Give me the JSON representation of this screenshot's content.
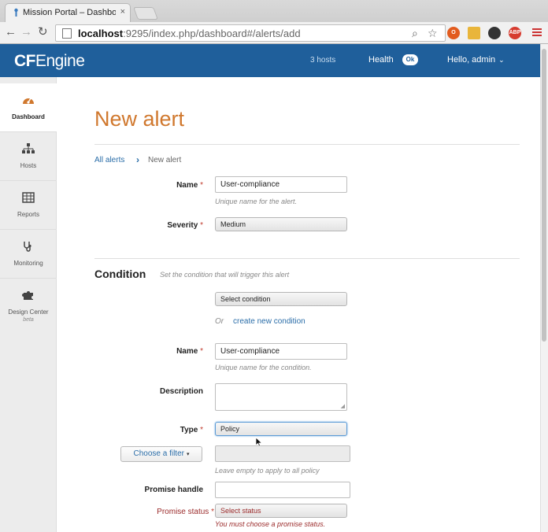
{
  "browser": {
    "tab_title": "Mission Portal – Dashboar",
    "tab_close": "×",
    "url_host": "localhost",
    "url_rest": ":9295/index.php/dashboard#/alerts/add",
    "extensions": {
      "abp_label": "ABP"
    }
  },
  "header": {
    "logo_bold": "CF",
    "logo_rest": "Engine",
    "hosts": "3 hosts",
    "health_label": "Health",
    "health_badge": "Ok",
    "user_menu": "Hello, admin",
    "brand_color": "#1f5f9b"
  },
  "sidebar": {
    "items": [
      {
        "label": "Dashboard",
        "icon": "dashboard-gauge-icon",
        "active": true
      },
      {
        "label": "Hosts",
        "icon": "hosts-hierarchy-icon",
        "active": false
      },
      {
        "label": "Reports",
        "icon": "reports-table-icon",
        "active": false
      },
      {
        "label": "Monitoring",
        "icon": "monitoring-stethoscope-icon",
        "active": false
      },
      {
        "label": "Design Center",
        "sub": "beta",
        "icon": "design-center-puzzle-icon",
        "active": false
      }
    ]
  },
  "main": {
    "page_title": "New alert",
    "title_color": "#d0782e",
    "breadcrumb": {
      "parent": "All alerts",
      "current": "New alert"
    },
    "alert": {
      "name_label": "Name",
      "name_value": "User-compliance",
      "name_hint": "Unique name for the alert.",
      "severity_label": "Severity",
      "severity_value": "Medium"
    },
    "condition": {
      "section_title": "Condition",
      "section_hint": "Set the condition that will trigger this alert",
      "select_value": "Select condition",
      "or_text": "Or",
      "create_link": "create new condition",
      "name_label": "Name",
      "name_value": "User-compliance",
      "name_hint": "Unique name for the condition.",
      "description_label": "Description",
      "description_value": "",
      "type_label": "Type",
      "type_value": "Policy",
      "filter_button": "Choose a filter",
      "filter_value": "",
      "filter_hint": "Leave empty to apply to all policy",
      "promise_handle_label": "Promise handle",
      "promise_handle_value": "",
      "promise_status_label": "Promise status",
      "promise_status_value": "Select status",
      "promise_status_error": "You must choose a promise status."
    },
    "required_marker": "*"
  }
}
